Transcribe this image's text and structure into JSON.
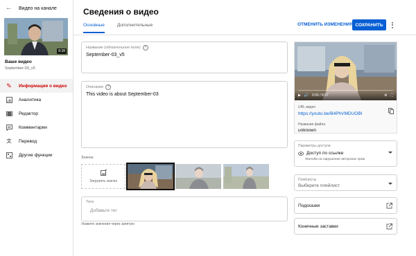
{
  "sidebar": {
    "back_label": "Видео на канале",
    "thumb_duration": "8:38",
    "your_video_label": "Ваше видео",
    "video_name": "September-03_v5",
    "items": [
      {
        "label": "Информация о видео",
        "icon": "pencil-icon",
        "active": true
      },
      {
        "label": "Аналитика",
        "icon": "analytics-icon",
        "active": false
      },
      {
        "label": "Редактор",
        "icon": "film-editor-icon",
        "active": false
      },
      {
        "label": "Комментарии",
        "icon": "comment-icon",
        "active": false
      },
      {
        "label": "Перевод",
        "icon": "translate-icon",
        "active": false
      },
      {
        "label": "Другие функции",
        "icon": "other-features-icon",
        "active": false
      }
    ]
  },
  "header": {
    "title": "Сведения о видео",
    "tabs": [
      "Основные",
      "Дополнительные"
    ],
    "undo_label": "ОТМЕНИТЬ ИЗМЕНЕНИЯ",
    "save_label": "СОХРАНИТЬ"
  },
  "form": {
    "title_label": "Название (обязательное поле)",
    "title_value": "September-03_v5",
    "description_label": "Описание",
    "description_value": "This video is about September-03",
    "thumbnails_label": "Значок",
    "upload_label": "Загрузить значок",
    "tags_label": "Теги",
    "tags_placeholder": "Добавьте тег",
    "tags_hint": "Укажите значения через запятую"
  },
  "preview": {
    "time": "0:00 / 8:37",
    "url_label": "URL видео",
    "url": "https://youtu.be/B4PhVMDUOBI",
    "filename_label": "Название файла",
    "filename": "unknown"
  },
  "access": {
    "label": "Параметры доступа",
    "value": "Доступ по ссылке",
    "sub": "Жалоба на нарушение авторских прав"
  },
  "playlists": {
    "label": "Плейлисты",
    "placeholder": "Выберите плейлист"
  },
  "links": {
    "cards": "Подсказки",
    "end_screens": "Конечные заставки"
  },
  "colors": {
    "accent": "#065fd4",
    "active_red": "#cc0000"
  }
}
